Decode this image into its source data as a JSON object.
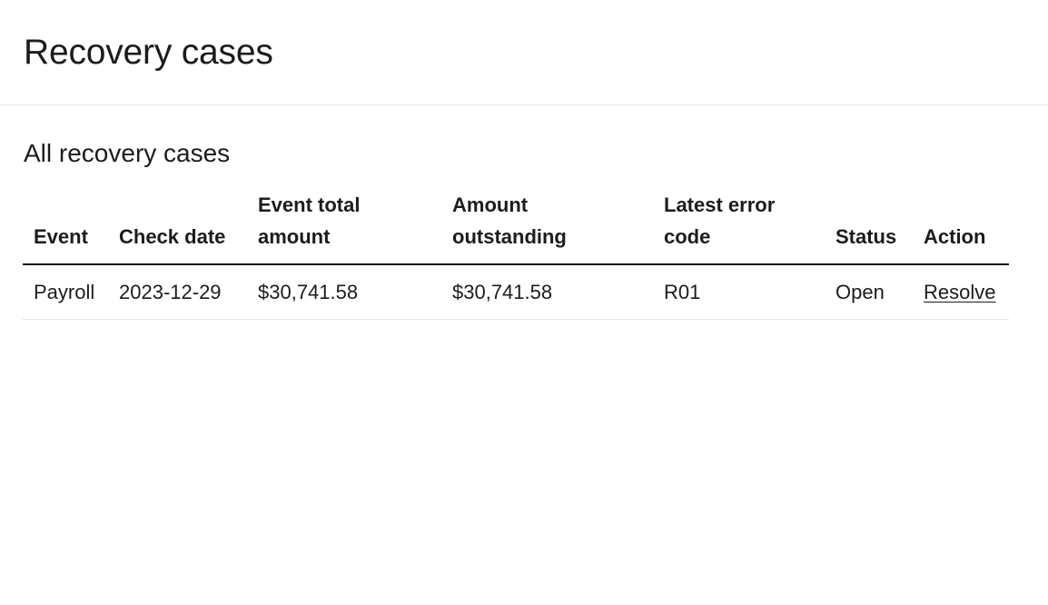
{
  "page": {
    "title": "Recovery cases"
  },
  "section": {
    "title": "All recovery cases"
  },
  "table": {
    "headers": {
      "event": "Event",
      "check_date": "Check date",
      "event_total_amount": "Event total amount",
      "amount_outstanding": "Amount outstanding",
      "latest_error_code": "Latest error code",
      "status": "Status",
      "action": "Action"
    },
    "rows": [
      {
        "event": "Payroll",
        "check_date": "2023-12-29",
        "event_total_amount": "$30,741.58",
        "amount_outstanding": "$30,741.58",
        "latest_error_code": "R01",
        "status": "Open",
        "action": "Resolve"
      }
    ]
  }
}
